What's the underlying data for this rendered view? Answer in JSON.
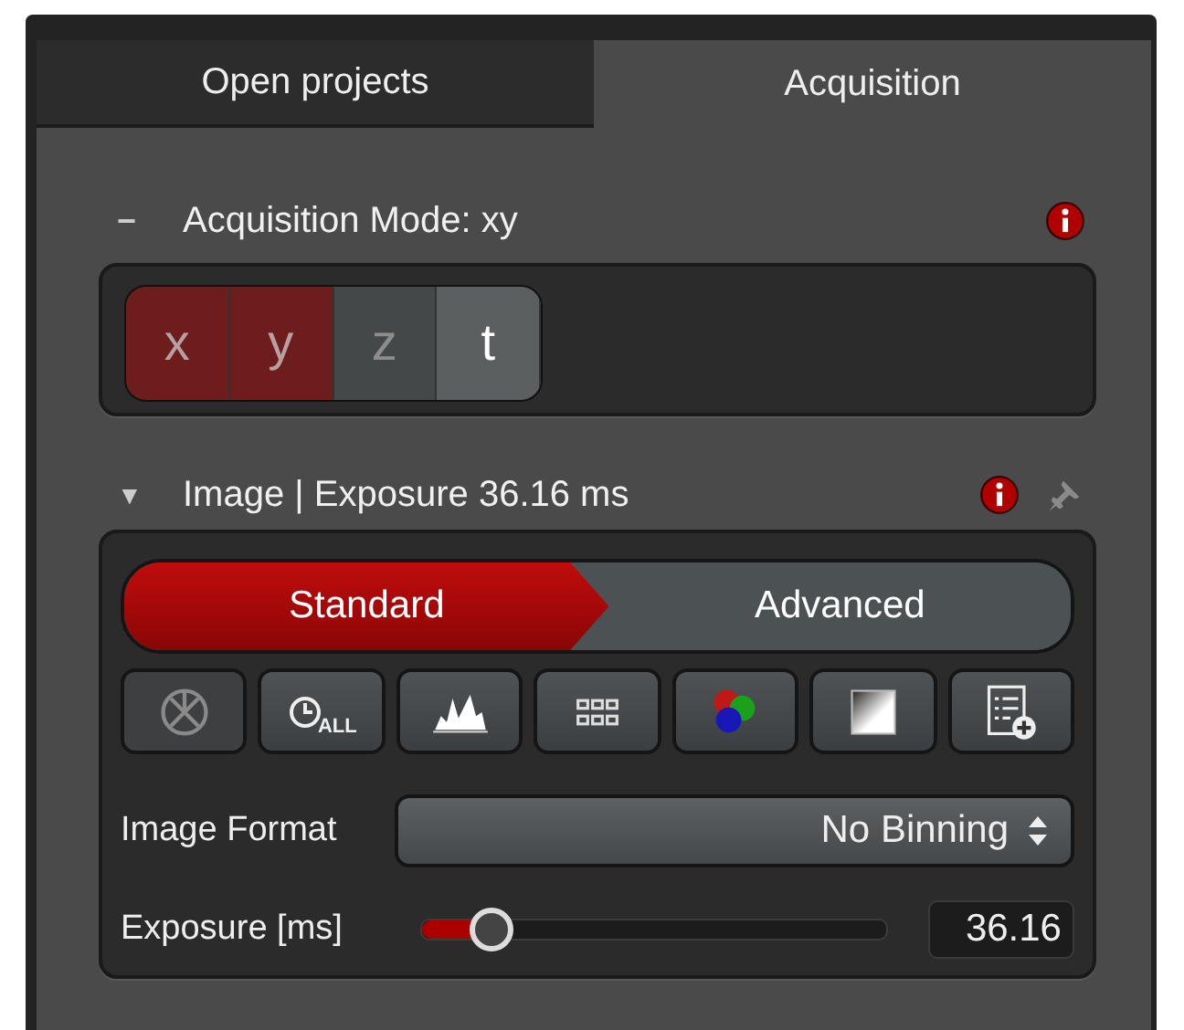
{
  "tabs": [
    {
      "label": "Open projects",
      "selected": false
    },
    {
      "label": "Acquisition",
      "selected": true
    }
  ],
  "acquisition_mode": {
    "collapse_glyph": "−",
    "title": "Acquisition Mode: xy",
    "info": true,
    "modes": [
      {
        "label": "x",
        "selected": true,
        "disabled": false
      },
      {
        "label": "y",
        "selected": true,
        "disabled": false
      },
      {
        "label": "z",
        "selected": false,
        "disabled": true
      },
      {
        "label": "t",
        "selected": false,
        "disabled": false
      }
    ]
  },
  "image": {
    "expand_glyph": "▼",
    "title": "Image | Exposure 36.16 ms",
    "info": true,
    "pinned": false,
    "modes": [
      {
        "label": "Standard",
        "selected": true
      },
      {
        "label": "Advanced",
        "selected": false
      }
    ],
    "tools": [
      {
        "kind": "aperture",
        "disabled": true
      },
      {
        "kind": "clock",
        "label": "ALL",
        "disabled": false
      },
      {
        "kind": "histogram",
        "disabled": false
      },
      {
        "kind": "grid",
        "disabled": false
      },
      {
        "kind": "channels",
        "disabled": false
      },
      {
        "kind": "gradient",
        "disabled": false
      },
      {
        "kind": "list-add",
        "disabled": false
      }
    ],
    "image_format": {
      "label": "Image Format",
      "value": "No Binning"
    },
    "exposure": {
      "label": "Exposure [ms]",
      "level": 0.15,
      "value": "36.16"
    }
  }
}
